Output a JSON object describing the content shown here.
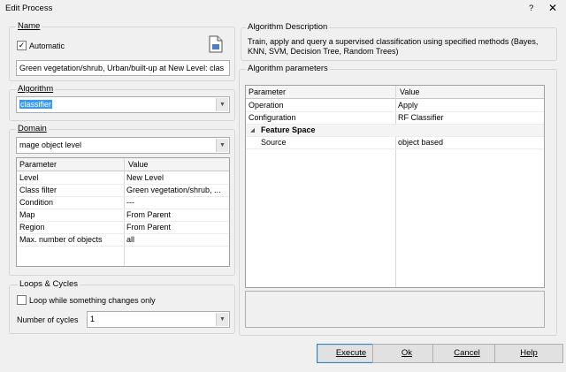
{
  "window": {
    "title": "Edit Process",
    "help_glyph": "?",
    "close_glyph": "✕"
  },
  "name_group": {
    "label": "Name",
    "automatic_label": "Automatic",
    "automatic_checked": true,
    "check_glyph": "✓",
    "name_value": "Green vegetation/shrub, Urban/built-up at  New Level: clas",
    "icon": "edit-document-icon"
  },
  "algorithm_group": {
    "label": "Algorithm",
    "selected": "classifier"
  },
  "domain_group": {
    "label": "Domain",
    "selected": "mage object level",
    "table": {
      "headers": [
        "Parameter",
        "Value"
      ],
      "rows": [
        [
          "Level",
          "New Level"
        ],
        [
          "Class filter",
          "Green vegetation/shrub, ..."
        ],
        [
          "Condition",
          "---"
        ],
        [
          "Map",
          "From Parent"
        ],
        [
          "Region",
          "From Parent"
        ],
        [
          "Max. number of objects",
          "all"
        ]
      ]
    }
  },
  "loops_group": {
    "label": "Loops & Cycles",
    "loop_label": "Loop while something changes only",
    "loop_checked": false,
    "cycles_label": "Number of cycles",
    "cycles_value": "1"
  },
  "description_group": {
    "label": "Algorithm Description",
    "text": "Train, apply and query a supervised classification using specified methods (Bayes, KNN, SVM, Decision Tree, Random Trees)"
  },
  "params_group": {
    "label": "Algorithm parameters",
    "headers": [
      "Parameter",
      "Value"
    ],
    "rows": [
      [
        "Operation",
        "Apply"
      ],
      [
        "Configuration",
        "RF Classifier"
      ]
    ],
    "section": {
      "label": "Feature Space",
      "collapse_glyph": "◢"
    },
    "section_rows": [
      [
        "Source",
        "object based"
      ]
    ]
  },
  "combo_arrow_glyph": "▼",
  "buttons": {
    "execute": "Execute",
    "ok": "Ok",
    "cancel": "Cancel",
    "help": "Help"
  }
}
